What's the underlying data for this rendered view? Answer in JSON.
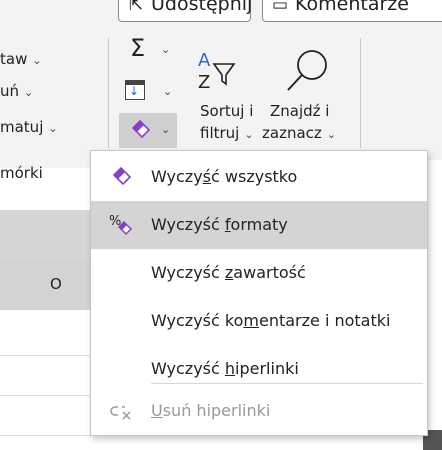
{
  "ribbon": {
    "share_button": "Udostępnij",
    "comments_button": "Komentarze",
    "cells_group": {
      "insert_label": "taw",
      "delete_label": "uń",
      "format_label": "matuj",
      "group_label": "mórki"
    },
    "editing": {
      "sort_label_1": "Sortuj i",
      "sort_label_2": "filtruj",
      "find_label_1": "Znajdź i",
      "find_label_2": "zaznacz"
    }
  },
  "sheet": {
    "column_header": "O"
  },
  "menu": {
    "items": [
      {
        "pre": "Wyczy",
        "key": "ś",
        "post": "ć wszystko",
        "state": "normal"
      },
      {
        "pre": "Wyczyść ",
        "key": "f",
        "post": "ormaty",
        "state": "hover"
      },
      {
        "pre": "Wyczyść ",
        "key": "z",
        "post": "awartość",
        "state": "normal"
      },
      {
        "pre": "Wyczyść ko",
        "key": "m",
        "post": "entarze i notatki",
        "state": "normal"
      },
      {
        "pre": "Wyczyść ",
        "key": "h",
        "post": "iperlinki",
        "state": "normal"
      },
      {
        "pre": "",
        "key": "U",
        "post": "suń hiperlinki",
        "state": "disabled"
      }
    ]
  },
  "colors": {
    "eraser": "#8a3ec8",
    "accent_blue": "#2b6cc4",
    "hover": "#d4d4d4"
  }
}
